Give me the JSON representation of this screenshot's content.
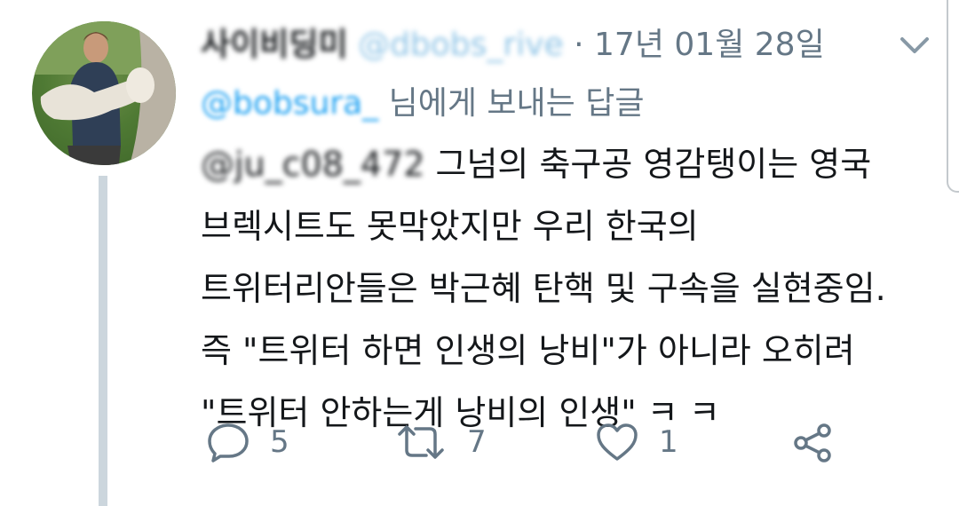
{
  "tweet": {
    "author_name": "사이비딩미",
    "author_handle": "@dbobs_rive",
    "separator": "·",
    "date": "17년 01월 28일",
    "reply_to_handle": "@bobsura_",
    "reply_to_suffix": "님에게 보내는 답글",
    "mention": "@ju_c08_472",
    "text_lines": [
      " 그넘의 축구공 영감탱이는 영국",
      "브렉시트도 못막았지만 우리 한국의",
      "트위터리안들은 박근혜 탄핵 및 구속을 실현중임.",
      "즉 \"트위터 하면 인생의 낭비\"가 아니라 오히려",
      "\"트위터 안하는게 낭비의 인생\" ㅋ ㅋ"
    ],
    "actions": {
      "reply_count": "5",
      "retweet_count": "7",
      "like_count": "1"
    }
  },
  "icons": {
    "reply": "reply-icon",
    "retweet": "retweet-icon",
    "like": "heart-icon",
    "share": "share-icon",
    "more": "chevron-down-icon"
  },
  "colors": {
    "text": "#14171a",
    "secondary": "#657786",
    "link": "#1da1f2",
    "thread_line": "#ccd6dd"
  }
}
